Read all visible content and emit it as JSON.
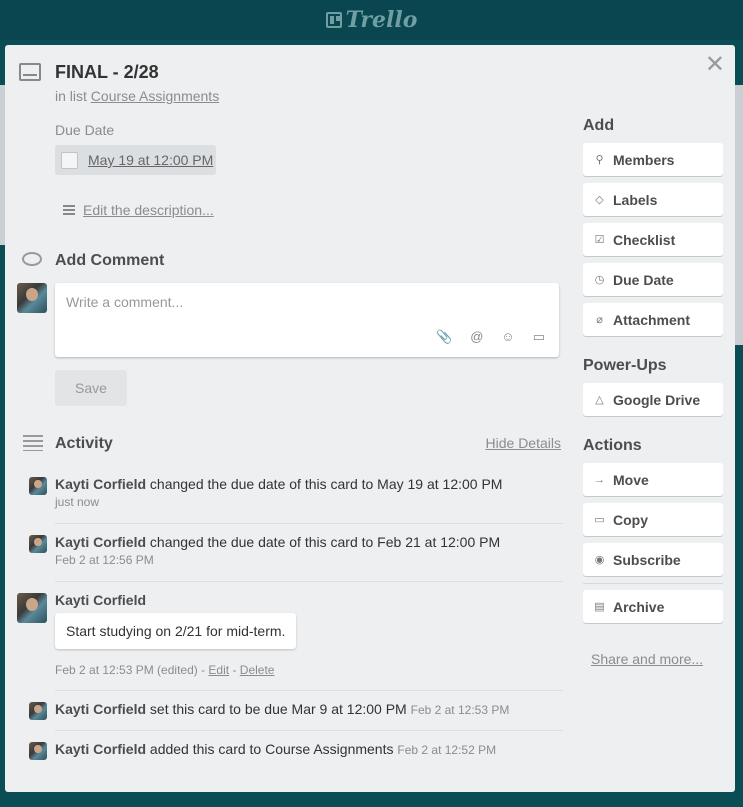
{
  "app": {
    "logo_text": "Trello"
  },
  "card": {
    "title": "FINAL - 2/28",
    "in_list_prefix": "in list",
    "list_name": "Course Assignments",
    "due_label": "Due Date",
    "due_value": "May 19 at 12:00 PM",
    "edit_description": "Edit the description..."
  },
  "comment": {
    "section_title": "Add Comment",
    "placeholder": "Write a comment...",
    "save_label": "Save"
  },
  "activity": {
    "section_title": "Activity",
    "hide_details": "Hide Details",
    "items": [
      {
        "user": "Kayti Corfield",
        "text": "changed the due date of this card to May 19 at 12:00 PM",
        "time": "just now"
      },
      {
        "user": "Kayti Corfield",
        "text": "changed the due date of this card to Feb 21 at 12:00 PM",
        "time": "Feb 2 at 12:56 PM"
      },
      {
        "user": "Kayti Corfield",
        "comment": "Start studying on 2/21 for mid-term.",
        "time": "Feb 2 at 12:53 PM (edited)",
        "edit": "Edit",
        "delete": "Delete"
      },
      {
        "user": "Kayti Corfield",
        "text": "set this card to be due Mar 9 at 12:00 PM",
        "time": "Feb 2 at 12:53 PM"
      },
      {
        "user": "Kayti Corfield",
        "text": "added this card to Course Assignments",
        "time": "Feb 2 at 12:52 PM"
      }
    ]
  },
  "sidebar": {
    "add_title": "Add",
    "add_items": [
      "Members",
      "Labels",
      "Checklist",
      "Due Date",
      "Attachment"
    ],
    "powerups_title": "Power-Ups",
    "powerups_items": [
      "Google Drive"
    ],
    "actions_title": "Actions",
    "actions_items": [
      "Move",
      "Copy",
      "Subscribe",
      "Archive"
    ],
    "share": "Share and more..."
  },
  "colors": {
    "background": "#0b4d55",
    "modal": "#edeff0",
    "button": "#ffffff"
  }
}
